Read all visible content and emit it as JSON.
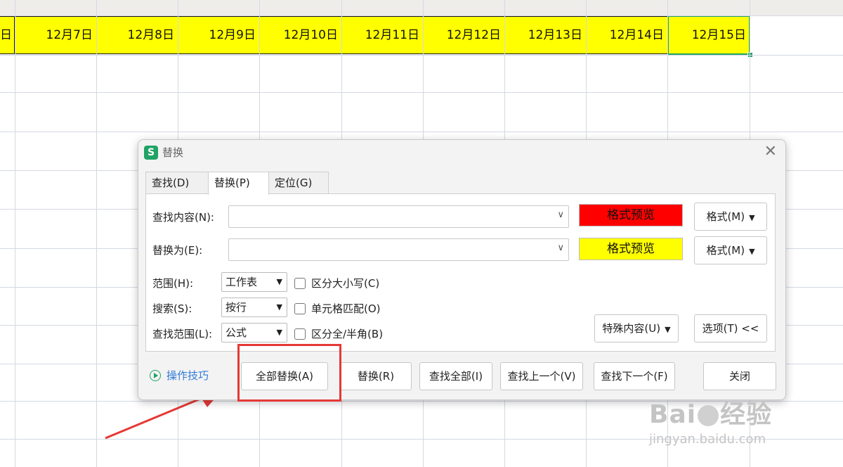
{
  "sheet": {
    "dates": [
      "日",
      "12月7日",
      "12月8日",
      "12月9日",
      "12月10日",
      "12月11日",
      "12月12日",
      "12月13日",
      "12月14日",
      "12月15日"
    ]
  },
  "dialog": {
    "title": "替换",
    "tabs": [
      "查找(D)",
      "替换(P)",
      "定位(G)"
    ],
    "find_label": "查找内容(N):",
    "find_value": "",
    "replace_label": "替换为(E):",
    "replace_value": "",
    "find_preview": "格式预览",
    "replace_preview": "格式预览",
    "format_button": "格式(M)",
    "scope_label": "范围(H):",
    "scope_value": "工作表",
    "search_label": "搜索(S):",
    "search_value": "按行",
    "lookin_label": "查找范围(L):",
    "lookin_value": "公式",
    "match_case": "区分大小写(C)",
    "match_cell": "单元格匹配(O)",
    "match_width": "区分全/半角(B)",
    "special_button": "特殊内容(U)",
    "options_button": "选项(T) <<",
    "tips": "操作技巧",
    "buttons": [
      "全部替换(A)",
      "替换(R)",
      "查找全部(I)",
      "查找上一个(V)",
      "查找下一个(F)",
      "关闭"
    ]
  },
  "colors": {
    "find_preview_bg": "#ff0000",
    "replace_preview_bg": "#ffff00",
    "row_highlight": "#ffff00",
    "active_cell_border": "#21a366"
  },
  "watermark": {
    "logo": "Baidu经验",
    "url": "jingyan.baidu.com"
  }
}
